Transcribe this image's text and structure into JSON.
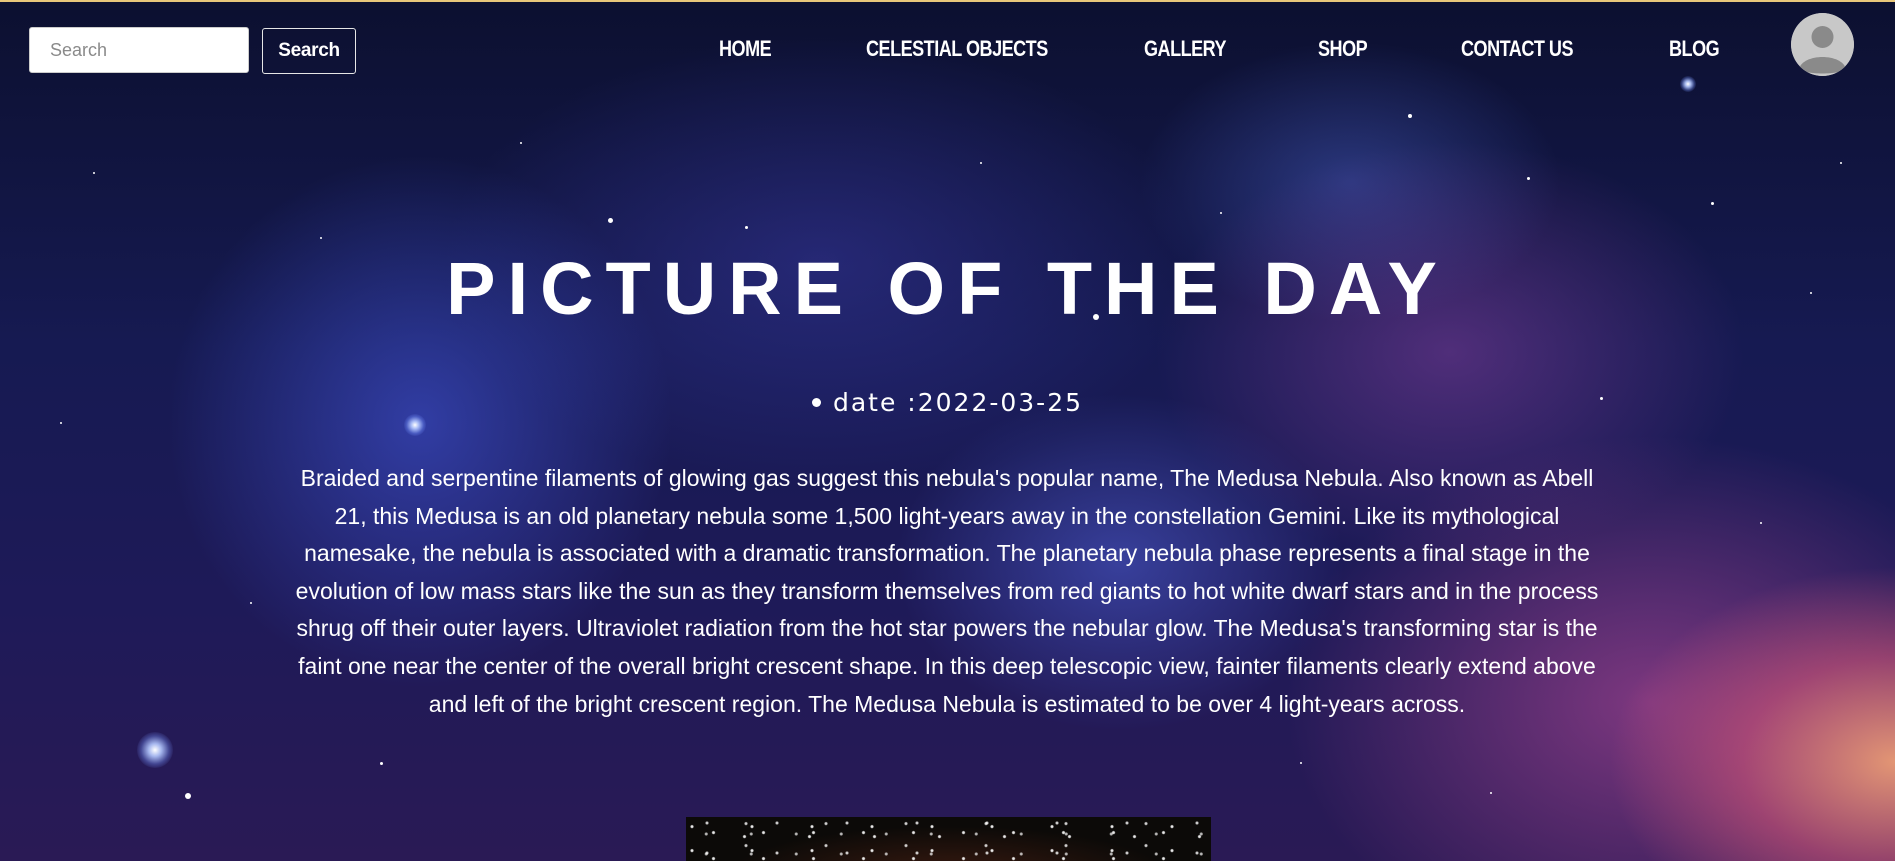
{
  "header": {
    "search": {
      "placeholder": "Search",
      "value": ""
    },
    "search_button": "Search",
    "nav": [
      {
        "label": "HOME"
      },
      {
        "label": "CELESTIAL OBJECTS"
      },
      {
        "label": "GALLERY"
      },
      {
        "label": "SHOP"
      },
      {
        "label": "CONTACT US"
      },
      {
        "label": "BLOG"
      }
    ]
  },
  "hero": {
    "title": "PICTURE OF THE DAY",
    "date_text": "date :2022-03-25",
    "description": "Braided and serpentine filaments of glowing gas suggest this nebula's popular name, The Medusa Nebula. Also known as Abell 21, this Medusa is an old planetary nebula some 1,500 light-years away in the constellation Gemini. Like its mythological namesake, the nebula is associated with a dramatic transformation. The planetary nebula phase represents a final stage in the evolution of low mass stars like the sun as they transform themselves from red giants to hot white dwarf stars and in the process shrug off their outer layers. Ultraviolet radiation from the hot star powers the nebular glow. The Medusa's transforming star is the faint one near the center of the overall bright crescent shape. In this deep telescopic view, fainter filaments clearly extend above and left of the bright crescent region. The Medusa Nebula is estimated to be over 4 light-years across."
  },
  "colors": {
    "top_border": "#e8c77a",
    "text": "#ffffff",
    "search_bg": "#ffffff",
    "avatar_bg": "#c8c8c8"
  },
  "icons": {
    "avatar": "user-avatar-icon",
    "date_bullet": "bullet-dot-icon"
  }
}
